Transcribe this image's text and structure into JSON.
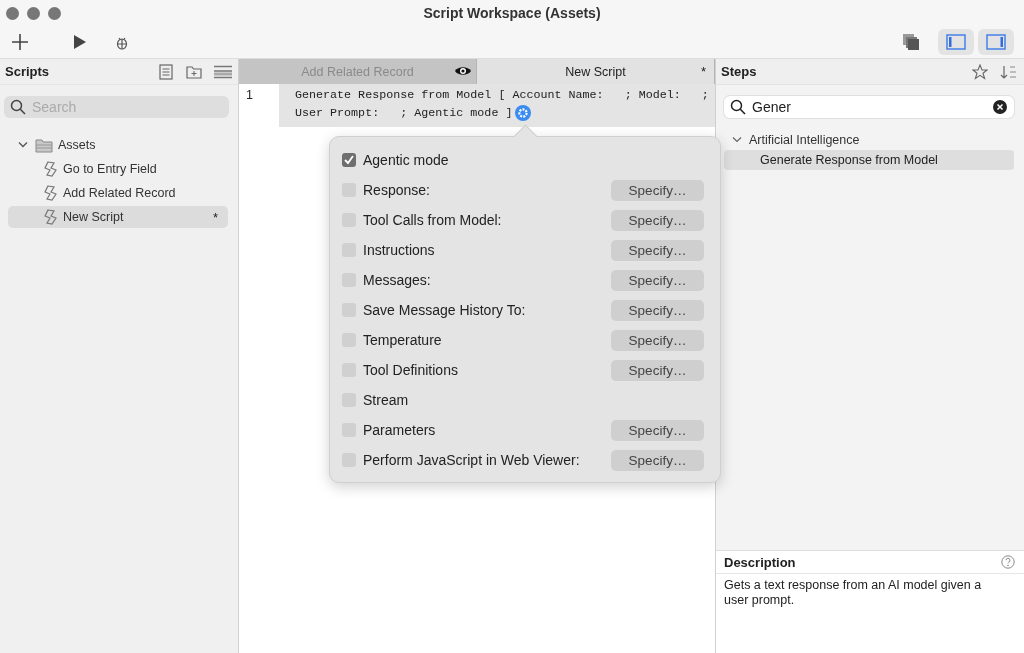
{
  "window": {
    "title": "Script Workspace (Assets)"
  },
  "toolbar": {
    "panel_toggles": [
      {
        "kind": "left",
        "selected": true
      },
      {
        "kind": "right",
        "selected": true
      }
    ]
  },
  "scripts_panel": {
    "title": "Scripts",
    "search": {
      "placeholder": "Search"
    },
    "tree": [
      {
        "label": "Assets",
        "kind": "folder",
        "expanded": true,
        "children": [
          {
            "label": "Go to Entry Field",
            "kind": "script",
            "selected": false
          },
          {
            "label": "Add Related Record",
            "kind": "script",
            "selected": false
          },
          {
            "label": "New Script",
            "kind": "script",
            "selected": true,
            "marker": "*"
          }
        ]
      }
    ]
  },
  "tabs": [
    {
      "label": "Add Related Record",
      "selected": false,
      "kind": "viewing"
    },
    {
      "label": "New Script",
      "selected": true,
      "kind": "modified",
      "marker": "*"
    }
  ],
  "editor": {
    "lines": [
      {
        "number": "1",
        "text_lines": [
          "Generate Response from Model [ Account Name:   ; Model:   ;",
          "User Prompt:   ; Agentic mode ]"
        ]
      }
    ]
  },
  "popover": {
    "options": [
      {
        "label": "Agentic mode",
        "checked": true
      },
      {
        "label": "Response:",
        "checked": false,
        "button": "Specify…"
      },
      {
        "label": "Tool Calls from Model:",
        "checked": false,
        "button": "Specify…"
      },
      {
        "label": "Instructions",
        "checked": false,
        "button": "Specify…"
      },
      {
        "label": "Messages:",
        "checked": false,
        "button": "Specify…"
      },
      {
        "label": "Save Message History To:",
        "checked": false,
        "button": "Specify…"
      },
      {
        "label": "Temperature",
        "checked": false,
        "button": "Specify…"
      },
      {
        "label": "Tool Definitions",
        "checked": false,
        "button": "Specify…"
      },
      {
        "label": "Stream",
        "checked": false
      },
      {
        "label": "Parameters",
        "checked": false,
        "button": "Specify…"
      },
      {
        "label": "Perform JavaScript in Web Viewer:",
        "checked": false,
        "button": "Specify…"
      }
    ]
  },
  "steps_panel": {
    "title": "Steps",
    "search": {
      "value": "Gener"
    },
    "groups": [
      {
        "label": "Artificial Intelligence",
        "expanded": true,
        "children": [
          {
            "label": "Generate Response from Model",
            "selected": true
          }
        ]
      }
    ]
  },
  "description": {
    "title": "Description",
    "text": "Gets a text response from an AI model given a user prompt."
  }
}
